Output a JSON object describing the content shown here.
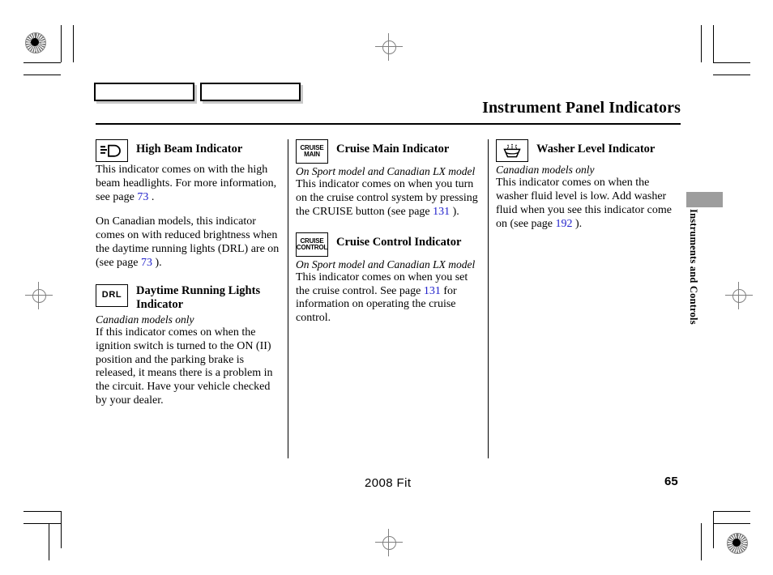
{
  "page": {
    "title": "Instrument Panel Indicators",
    "side_tab_label": "Instruments and Controls",
    "footer_model": "2008  Fit",
    "footer_page_number": "65",
    "link_color": "#2020cc"
  },
  "columns": [
    {
      "id": "column-1",
      "blocks": [
        {
          "id": "high-beam-indicator",
          "icon_name": "high-beam-icon",
          "icon_label": "",
          "title": "High Beam Indicator",
          "italic_note": "",
          "paragraphs": [
            {
              "runs": [
                {
                  "text": "This indicator comes on with the high beam headlights. For more information, see page "
                },
                {
                  "text": "73",
                  "style": "link"
                },
                {
                  "text": "  ."
                }
              ]
            },
            {
              "spaced": true,
              "runs": [
                {
                  "text": "On Canadian models, this indicator comes on with reduced brightness when the daytime running lights (DRL) are on (see page "
                },
                {
                  "text": "73",
                  "style": "link"
                },
                {
                  "text": " )."
                }
              ]
            }
          ]
        },
        {
          "id": "daytime-running-lights-indicator",
          "icon_name": "drl-text-icon",
          "icon_label": "DRL",
          "title": "Daytime Running Lights Indicator",
          "italic_note": "Canadian models only",
          "paragraphs": [
            {
              "runs": [
                {
                  "text": "If this indicator comes on when the ignition switch is turned to the ON (II) position and the parking brake is released, it means there is a problem in the circuit. Have your vehicle checked by your dealer."
                }
              ]
            }
          ]
        }
      ]
    },
    {
      "id": "column-2",
      "blocks": [
        {
          "id": "cruise-main-indicator",
          "icon_name": "cruise-main-text-icon",
          "icon_label_line1": "CRUISE",
          "icon_label_line2": "MAIN",
          "title": "Cruise Main Indicator",
          "italic_note": "On Sport model and Canadian LX model",
          "paragraphs": [
            {
              "runs": [
                {
                  "text": "This indicator comes on when you turn on the cruise control system by pressing the CRUISE button (see page "
                },
                {
                  "text": "131",
                  "style": "link"
                },
                {
                  "text": " )."
                }
              ]
            }
          ]
        },
        {
          "id": "cruise-control-indicator",
          "icon_name": "cruise-control-text-icon",
          "icon_label_line1": "CRUISE",
          "icon_label_line2": "CONTROL",
          "title": "Cruise Control Indicator",
          "italic_note": "On Sport model and Canadian LX model",
          "paragraphs": [
            {
              "runs": [
                {
                  "text": "This indicator comes on when you set the cruise control. See page "
                },
                {
                  "text": " 131",
                  "style": "link"
                },
                {
                  "text": " for information on operating the cruise control."
                }
              ]
            }
          ]
        }
      ]
    },
    {
      "id": "column-3",
      "blocks": [
        {
          "id": "washer-level-indicator",
          "icon_name": "washer-fluid-icon",
          "icon_label": "",
          "title": "Washer Level Indicator",
          "italic_note": " Canadian models only",
          "paragraphs": [
            {
              "runs": [
                {
                  "text": "This indicator comes on when the washer fluid level is low. Add washer fluid when you see this indicator come on (see page "
                },
                {
                  "text": "192",
                  "style": "link"
                },
                {
                  "text": " )."
                }
              ]
            }
          ]
        }
      ]
    }
  ]
}
